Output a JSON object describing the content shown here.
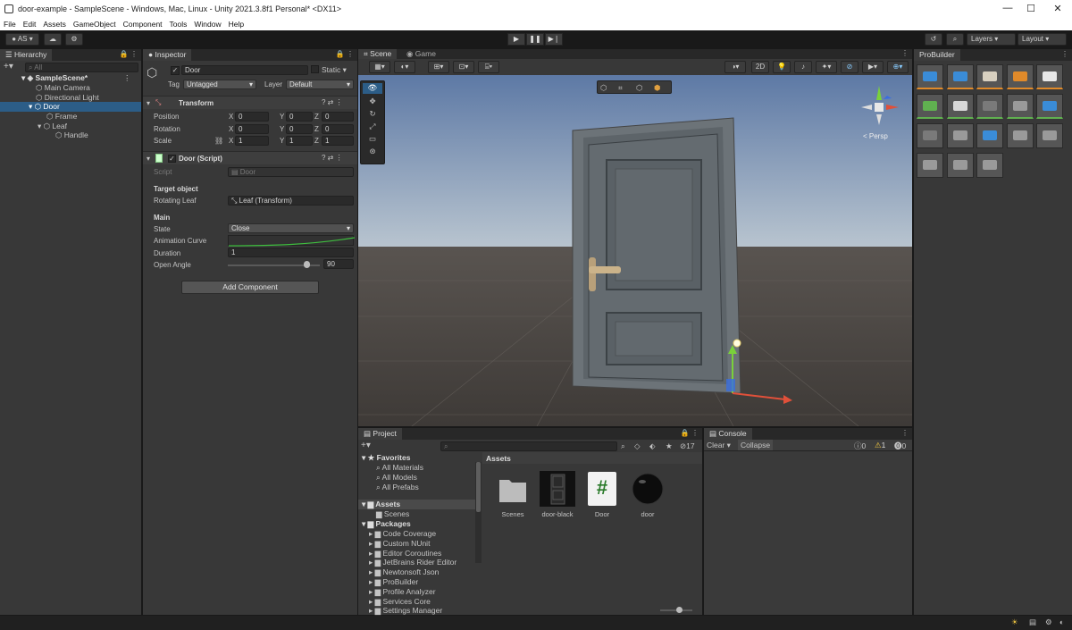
{
  "window": {
    "title": "door-example - SampleScene - Windows, Mac, Linux - Unity 2021.3.8f1 Personal* <DX11>",
    "min": "—",
    "max": "☐",
    "close": "✕"
  },
  "menu": [
    "File",
    "Edit",
    "Assets",
    "GameObject",
    "Component",
    "Tools",
    "Window",
    "Help"
  ],
  "toolbar": {
    "account": "AS",
    "layers": "Layers",
    "layout": "Layout"
  },
  "hierarchy": {
    "tab": "Hierarchy",
    "search_placeholder": "All",
    "scene": "SampleScene*",
    "items": [
      "Main Camera",
      "Directional Light",
      "Door",
      "Frame",
      "Leaf",
      "Handle"
    ]
  },
  "inspector": {
    "tab": "Inspector",
    "object_name": "Door",
    "static": "Static",
    "tag_label": "Tag",
    "tag_value": "Untagged",
    "layer_label": "Layer",
    "layer_value": "Default",
    "transform": {
      "title": "Transform",
      "position": "Position",
      "rotation": "Rotation",
      "scale": "Scale",
      "pos": [
        "0",
        "0",
        "0"
      ],
      "rot": [
        "0",
        "0",
        "0"
      ],
      "scl": [
        "1",
        "1",
        "1"
      ]
    },
    "script": {
      "title": "Door (Script)",
      "script_label": "Script",
      "script_value": "Door",
      "target_header": "Target object",
      "rotating_leaf": "Rotating Leaf",
      "rotating_leaf_value": "Leaf (Transform)",
      "main_header": "Main",
      "state": "State",
      "state_value": "Close",
      "anim_curve": "Animation Curve",
      "duration": "Duration",
      "duration_value": "1",
      "open_angle": "Open Angle",
      "open_angle_value": "90",
      "open_angle_fraction": 0.85
    },
    "add_component": "Add Component"
  },
  "scene": {
    "tab_scene": "Scene",
    "tab_game": "Game",
    "persp": "< Persp",
    "btn_2d": "2D"
  },
  "project": {
    "tab": "Project",
    "favorites": "Favorites",
    "fav_items": [
      "All Materials",
      "All Models",
      "All Prefabs"
    ],
    "assets": "Assets",
    "asset_children": [
      "Scenes"
    ],
    "packages": "Packages",
    "package_items": [
      "Code Coverage",
      "Custom NUnit",
      "Editor Coroutines",
      "JetBrains Rider Editor",
      "Newtonsoft Json",
      "ProBuilder",
      "Profile Analyzer",
      "Services Core",
      "Settings Manager"
    ],
    "breadcrumb": "Assets",
    "hidden_count": "17",
    "grid": [
      "Scenes",
      "door-black",
      "Door",
      "door"
    ]
  },
  "console": {
    "tab": "Console",
    "clear": "Clear",
    "collapse": "Collapse",
    "counts": [
      "0",
      "1",
      "0"
    ]
  },
  "probuilder": {
    "tab": "ProBuilder"
  },
  "colors": {
    "accent": "#2c5d87",
    "selected": "#2c5d87",
    "orange": "#e08a2a"
  }
}
